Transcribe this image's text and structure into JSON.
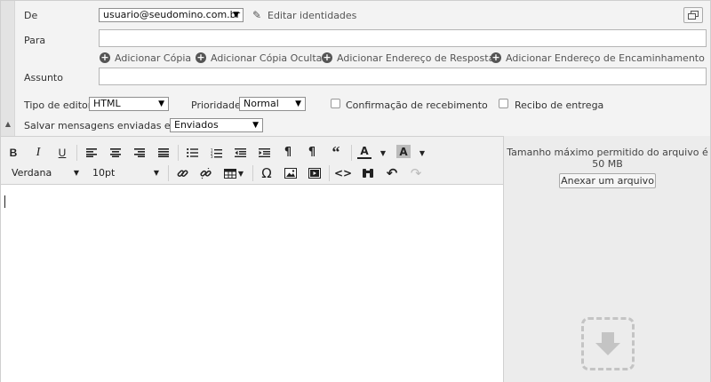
{
  "header": {
    "from_label": "De",
    "from_value": "usuario@seudomino.com.br",
    "edit_identities": "Editar identidades",
    "to_label": "Para",
    "to_value": "",
    "add_links": [
      "Adicionar Cópia",
      "Adicionar Cópia Oculta",
      "Adicionar Endereço de Resposta",
      "Adicionar Endereço de Encaminhamento"
    ],
    "subject_label": "Assunto",
    "subject_value": ""
  },
  "options": {
    "editor_type_label": "Tipo de editor",
    "editor_type_value": "HTML",
    "priority_label": "Prioridade",
    "priority_value": "Normal",
    "read_receipt_label": "Confirmação de recebimento",
    "delivery_receipt_label": "Recibo de entrega",
    "save_sent_label": "Salvar mensagens enviadas em",
    "save_sent_value": "Enviados"
  },
  "toolbar": {
    "bold": "B",
    "italic": "I",
    "underline": "U",
    "font_family": "Verdana",
    "font_size": "10pt",
    "text_color": "A",
    "bg_color": "A",
    "omega": "Ω"
  },
  "attachments": {
    "max_size_text": "Tamanho máximo permitido do arquivo é 50 MB",
    "attach_button": "Anexar um arquivo"
  }
}
